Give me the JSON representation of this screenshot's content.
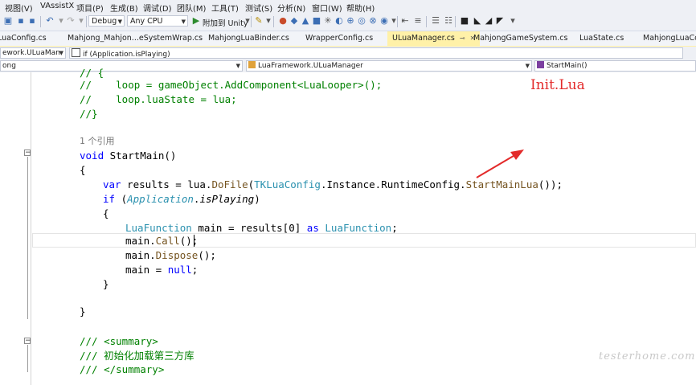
{
  "menubar": {
    "items": [
      "视图(V)",
      "VAssistX",
      "项目(P)",
      "生成(B)",
      "调试(D)",
      "团队(M)",
      "工具(T)",
      "测试(S)",
      "分析(N)",
      "窗口(W)",
      "帮助(H)"
    ]
  },
  "toolbar": {
    "config": "Debug",
    "platform": "Any CPU",
    "attach_label": "附加到 Unity",
    "icons": [
      "save-all-icon",
      "undo-icon",
      "redo-icon",
      "play-icon",
      "bookmark-icon"
    ]
  },
  "tabs": [
    {
      "label": "LuaConfig.cs",
      "active": false
    },
    {
      "label": "Mahjong_Mahjon...eSystemWrap.cs",
      "active": false
    },
    {
      "label": "MahjongLuaBinder.cs",
      "active": false
    },
    {
      "label": "WrapperConfig.cs",
      "active": false
    },
    {
      "label": "ULuaManager.cs",
      "active": true
    },
    {
      "label": "MahjongGameSystem.cs",
      "active": false
    },
    {
      "label": "LuaState.cs",
      "active": false
    },
    {
      "label": "MahjongLuaCon",
      "active": false
    }
  ],
  "navbar": {
    "left": "ework.ULuaMan",
    "breadcrumb": "if (Application.isPlaying)",
    "project": "ong",
    "class": "LuaFramework.ULuaManager",
    "member": "StartMain()"
  },
  "code": {
    "line0": "// {",
    "line1_a": "//    loop = gameObject.AddComponent<LuaLooper>();",
    "line2_a": "//    loop.luaState = lua;",
    "line3": "//}",
    "refs": "1 个引用",
    "sig_void": "void",
    "sig_name": " StartMain()",
    "brace_open": "{",
    "l_var": "var",
    "l_results": " results = lua.",
    "l_dofile": "DoFile",
    "l_paren": "(",
    "l_tkconfig": "TKLuaConfig",
    "l_rest1": ".Instance.RuntimeConfig.",
    "l_startmainlua": "StartMainLua",
    "l_rest2": "());",
    "if_kw": "if",
    "if_open": " (",
    "if_app": "Application",
    "if_dot": ".",
    "if_prop": "isPlaying",
    "if_close": ")",
    "brace_open2": "{",
    "lf_type": "LuaFunction",
    "lf_main": " main = results[0] ",
    "lf_as": "as",
    "lf_sp": " ",
    "lf_type2": "LuaFunction",
    "lf_semi": ";",
    "call_a": "main.",
    "call_m": "Call",
    "call_b": "();",
    "disp_a": "main.",
    "disp_m": "Dispose",
    "disp_b": "();",
    "null_a": "main = ",
    "null_kw": "null",
    "null_b": ";",
    "brace_close2": "}",
    "brace_close": "}",
    "doc1": "/// <summary>",
    "doc2": "/// 初始化加载第三方库",
    "doc3": "/// </summary>"
  },
  "annotation": "Init.Lua",
  "watermark": "testerhome.com",
  "colors": {
    "annotation": "#e32a2a",
    "comment": "#008000",
    "keyword": "#0000ff",
    "type": "#2b91af",
    "active_tab": "#fff1a8"
  }
}
